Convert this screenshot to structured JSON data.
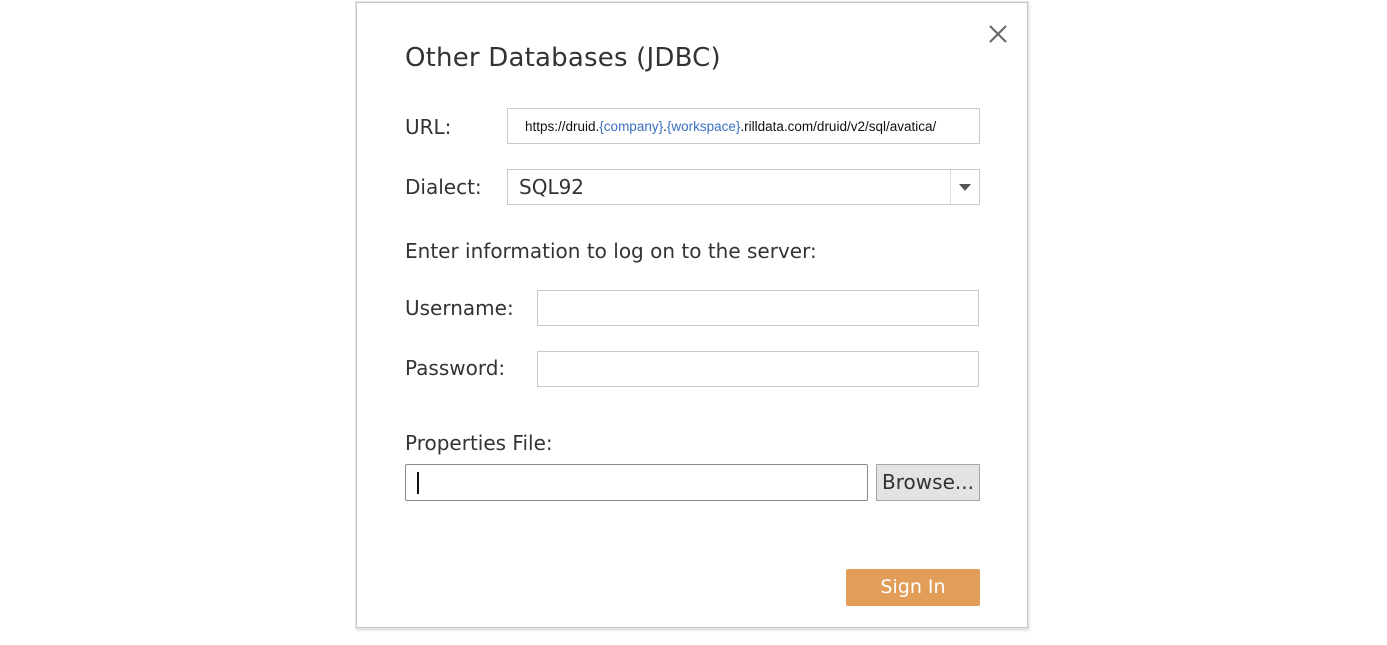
{
  "dialog": {
    "title": "Other Databases (JDBC)",
    "close_icon": "close-icon"
  },
  "url": {
    "label": "URL:",
    "value_parts": [
      {
        "text": "https://druid.",
        "highlight": false
      },
      {
        "text": "{company}",
        "highlight": true
      },
      {
        "text": ".",
        "highlight": false
      },
      {
        "text": "{workspace}",
        "highlight": true
      },
      {
        "text": ".rilldata.com/druid/v2/sql/avatica/",
        "highlight": false
      }
    ]
  },
  "dialect": {
    "label": "Dialect:",
    "selected": "SQL92",
    "dropdown_icon": "chevron-down-icon"
  },
  "login": {
    "heading": "Enter information to log on to the server:",
    "username_label": "Username:",
    "username_value": "",
    "password_label": "Password:",
    "password_value": ""
  },
  "properties": {
    "label": "Properties File:",
    "value": "",
    "browse_label": "Browse..."
  },
  "actions": {
    "sign_in_label": "Sign In"
  },
  "colors": {
    "accent": "#e29e59",
    "url_variable": "#3b6fc4"
  }
}
